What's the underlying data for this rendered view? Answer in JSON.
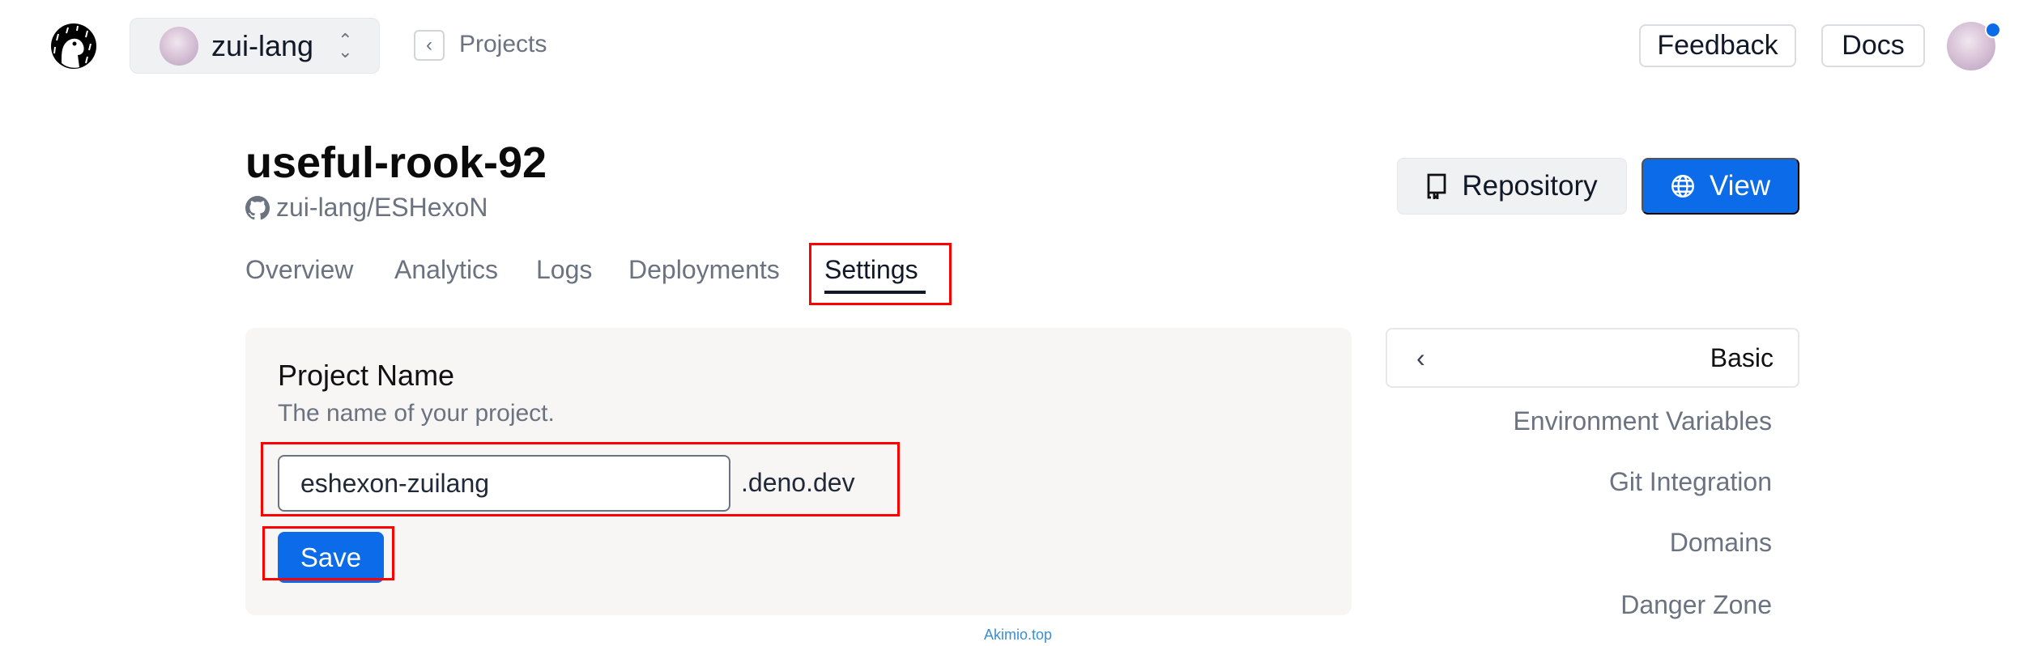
{
  "header": {
    "team_name": "zui-lang",
    "back_label": "Projects",
    "feedback_label": "Feedback",
    "docs_label": "Docs"
  },
  "project": {
    "title": "useful-rook-92",
    "repo": "zui-lang/ESHexoN",
    "repository_label": "Repository",
    "view_label": "View"
  },
  "tabs": [
    {
      "label": "Overview"
    },
    {
      "label": "Analytics"
    },
    {
      "label": "Logs"
    },
    {
      "label": "Deployments"
    },
    {
      "label": "Settings",
      "active": true
    }
  ],
  "settings": {
    "project_name_label": "Project Name",
    "project_name_desc": "The name of your project.",
    "project_name_value": "eshexon-zuilang",
    "domain_suffix": ".deno.dev",
    "save_label": "Save"
  },
  "sidebar": {
    "current": "Basic",
    "items": [
      {
        "label": "Environment Variables"
      },
      {
        "label": "Git Integration"
      },
      {
        "label": "Domains"
      },
      {
        "label": "Danger Zone"
      }
    ]
  },
  "watermark": "Akimio.top",
  "colors": {
    "accent": "#0b6be8",
    "highlight": "#ff0000",
    "card_bg": "#f7f6f5"
  }
}
